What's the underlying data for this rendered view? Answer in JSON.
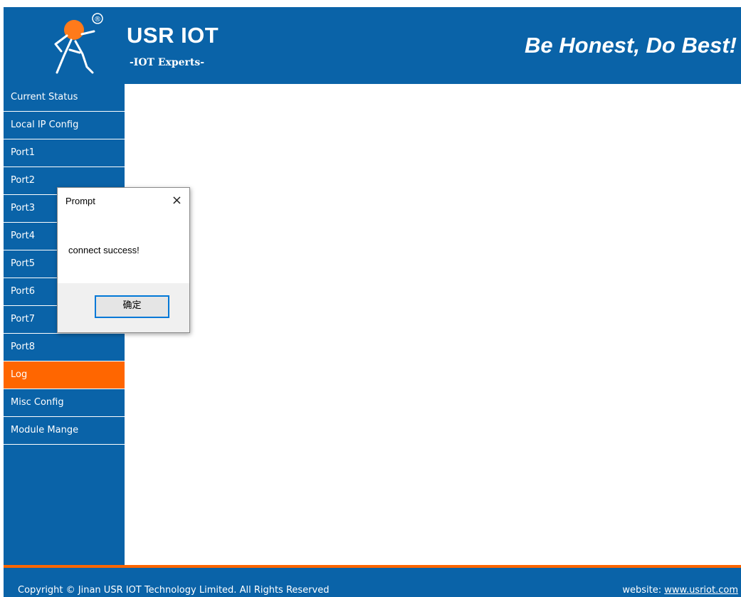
{
  "header": {
    "brand_title": "USR IOT",
    "brand_subtitle": "-IOT Experts-",
    "slogan": "Be Honest, Do Best!",
    "registered_mark": "®"
  },
  "sidebar": {
    "items": [
      {
        "label": "Current Status",
        "active": false
      },
      {
        "label": "Local IP Config",
        "active": false
      },
      {
        "label": "Port1",
        "active": false
      },
      {
        "label": "Port2",
        "active": false
      },
      {
        "label": "Port3",
        "active": false
      },
      {
        "label": "Port4",
        "active": false
      },
      {
        "label": "Port5",
        "active": false
      },
      {
        "label": "Port6",
        "active": false
      },
      {
        "label": "Port7",
        "active": false
      },
      {
        "label": "Port8",
        "active": false
      },
      {
        "label": "Log",
        "active": true
      },
      {
        "label": "Misc Config",
        "active": false
      },
      {
        "label": "Module Mange",
        "active": false
      }
    ]
  },
  "dialog": {
    "title": "Prompt",
    "close_icon": "×",
    "message": "connect success!",
    "ok_label": "确定"
  },
  "footer": {
    "copyright": "Copyright © Jinan USR IOT Technology Limited. All Rights Reserved",
    "website_label": "website:",
    "website_link": "www.usriot.com"
  },
  "colors": {
    "primary_blue": "#0a63a8",
    "accent_orange": "#ff6600",
    "dialog_button_border": "#0078d7"
  }
}
